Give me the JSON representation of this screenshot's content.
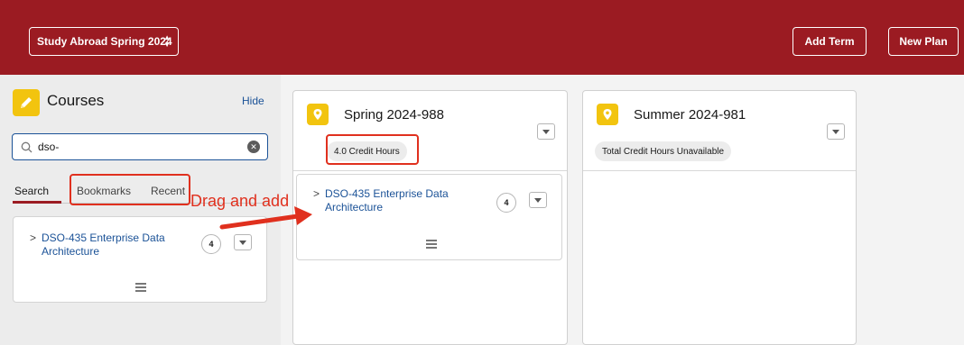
{
  "header": {
    "plan_select": "Study Abroad Spring 2024",
    "add_term_label": "Add Term",
    "new_plan_label": "New Plan"
  },
  "sidebar": {
    "title": "Courses",
    "hide_label": "Hide",
    "search_value": "dso-",
    "tabs": [
      {
        "label": "Search",
        "active": true
      },
      {
        "label": "Bookmarks",
        "active": false
      },
      {
        "label": "Recent",
        "active": false
      }
    ],
    "results": [
      {
        "name": "DSO-435 Enterprise Data Architecture",
        "name_line1": "DSO-435 Enterprise Data",
        "name_line2": "Architecture",
        "credits": "4"
      }
    ]
  },
  "terms": [
    {
      "title": "Spring 2024-988",
      "credit_pill": "4.0 Credit Hours",
      "courses": [
        {
          "name": "DSO-435 Enterprise Data Architecture",
          "name_line1": "DSO-435 Enterprise Data",
          "name_line2": "Architecture",
          "credits": "4"
        }
      ]
    },
    {
      "title": "Summer 2024-981",
      "credit_pill": "Total Credit Hours Unavailable",
      "courses": []
    }
  ],
  "annotation": {
    "drag_label": "Drag and add"
  },
  "colors": {
    "brand": "#9b1b22",
    "accent_yellow": "#f2c40f",
    "link": "#1b5297",
    "annotation_red": "#e0301e"
  },
  "icons": [
    "pencil-icon",
    "search-icon",
    "clear-icon",
    "location-pin-icon",
    "chevron-right-icon",
    "chevron-down-icon",
    "drag-handle-icon",
    "sort-updown-icon"
  ]
}
